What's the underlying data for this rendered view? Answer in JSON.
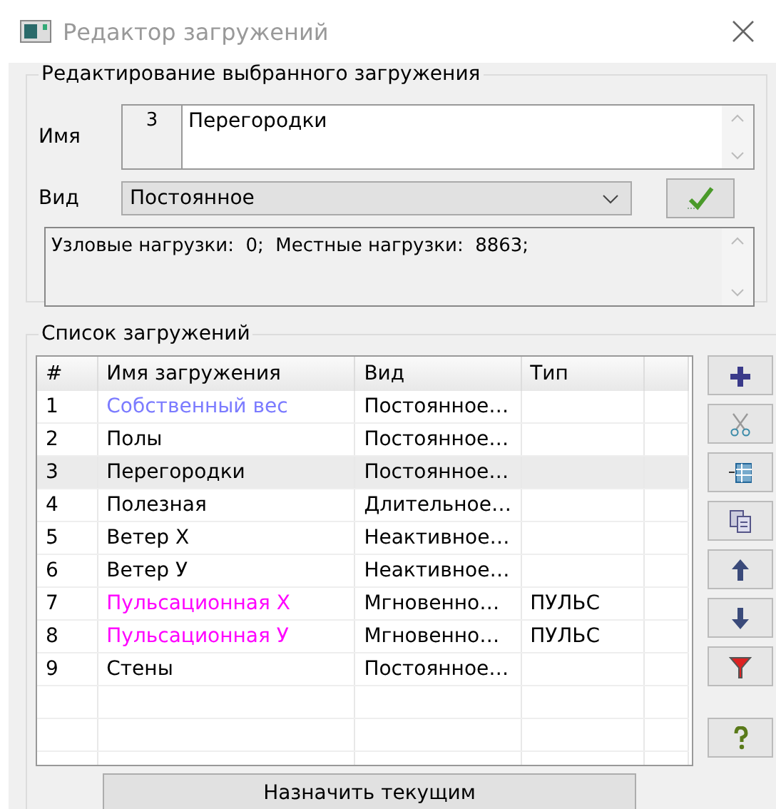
{
  "window": {
    "title": "Редактор загружений"
  },
  "edit_group": {
    "title": "Редактирование выбранного загружения",
    "name_label": "Имя",
    "number": "3",
    "name_value": "Перегородки",
    "kind_label": "Вид",
    "kind_value": "Постоянное",
    "info": "Узловые нагрузки:  0;  Местные нагрузки:  8863;"
  },
  "list_group": {
    "title": "Список загружений",
    "table": {
      "columns": [
        "#",
        "Имя загружения",
        "Вид",
        "Тип"
      ],
      "rows": [
        {
          "cells": [
            "1",
            "Собственный вес",
            "Постоянное…",
            ""
          ],
          "color": "#7b7bff",
          "selected": false
        },
        {
          "cells": [
            "2",
            "Полы",
            "Постоянное…",
            ""
          ],
          "color": "#000000",
          "selected": false
        },
        {
          "cells": [
            "3",
            "Перегородки",
            "Постоянное…",
            ""
          ],
          "color": "#000000",
          "selected": true
        },
        {
          "cells": [
            "4",
            "Полезная",
            "Длительное…",
            ""
          ],
          "color": "#000000",
          "selected": false
        },
        {
          "cells": [
            "5",
            "Ветер X",
            "Неактивное…",
            ""
          ],
          "color": "#000000",
          "selected": false
        },
        {
          "cells": [
            "6",
            "Ветер У",
            "Неактивное…",
            ""
          ],
          "color": "#000000",
          "selected": false
        },
        {
          "cells": [
            "7",
            "Пульсационная X",
            "Мгновенно…",
            "ПУЛЬС"
          ],
          "color": "#ff00ff",
          "selected": false
        },
        {
          "cells": [
            "8",
            "Пульсационная У",
            "Мгновенно…",
            "ПУЛЬС"
          ],
          "color": "#ff00ff",
          "selected": false
        },
        {
          "cells": [
            "9",
            "Стены",
            "Постоянное…",
            ""
          ],
          "color": "#000000",
          "selected": false
        }
      ]
    },
    "tools": [
      {
        "kind": "add"
      },
      {
        "kind": "cut"
      },
      {
        "kind": "insert"
      },
      {
        "kind": "copy"
      },
      {
        "kind": "up"
      },
      {
        "kind": "down"
      },
      {
        "kind": "filter"
      },
      {
        "kind": "help"
      }
    ],
    "assign_button": "Назначить текущим"
  }
}
